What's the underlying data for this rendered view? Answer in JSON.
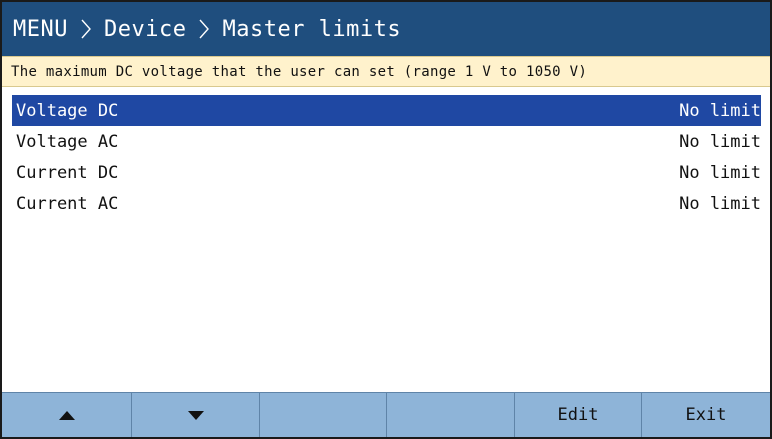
{
  "breadcrumb": {
    "items": [
      "MENU",
      "Device",
      "Master limits"
    ]
  },
  "hint": "The maximum DC voltage that the user can set (range 1 V to 1050 V)",
  "list": {
    "items": [
      {
        "label": "Voltage DC",
        "value": "No limit",
        "selected": true
      },
      {
        "label": "Voltage AC",
        "value": "No limit",
        "selected": false
      },
      {
        "label": "Current DC",
        "value": "No limit",
        "selected": false
      },
      {
        "label": "Current AC",
        "value": "No limit",
        "selected": false
      }
    ]
  },
  "softkeys": {
    "up_icon": "triangle-up-icon",
    "down_icon": "triangle-down-icon",
    "edit_label": "Edit",
    "exit_label": "Exit"
  },
  "colors": {
    "title_bg": "#1f4e7e",
    "hint_bg": "#fff2cc",
    "selection_bg": "#1f48a3",
    "softkey_bg": "#8eb4d8"
  }
}
